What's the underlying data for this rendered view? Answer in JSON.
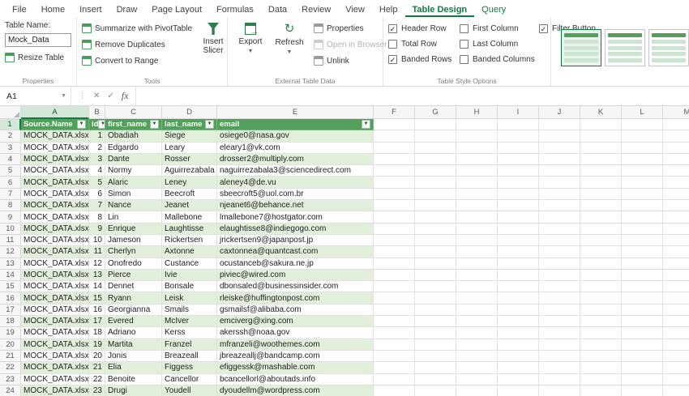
{
  "menubar": {
    "items": [
      {
        "label": "File",
        "active": false,
        "accent": false
      },
      {
        "label": "Home",
        "active": false,
        "accent": false
      },
      {
        "label": "Insert",
        "active": false,
        "accent": false
      },
      {
        "label": "Draw",
        "active": false,
        "accent": false
      },
      {
        "label": "Page Layout",
        "active": false,
        "accent": false
      },
      {
        "label": "Formulas",
        "active": false,
        "accent": false
      },
      {
        "label": "Data",
        "active": false,
        "accent": false
      },
      {
        "label": "Review",
        "active": false,
        "accent": false
      },
      {
        "label": "View",
        "active": false,
        "accent": false
      },
      {
        "label": "Help",
        "active": false,
        "accent": false
      },
      {
        "label": "Table Design",
        "active": true,
        "accent": false
      },
      {
        "label": "Query",
        "active": false,
        "accent": true
      }
    ]
  },
  "ribbon": {
    "properties_group": {
      "label": "Properties",
      "table_name_label": "Table Name:",
      "table_name_value": "Mock_Data",
      "resize_button": "Resize Table"
    },
    "tools_group": {
      "label": "Tools",
      "items": [
        "Summarize with PivotTable",
        "Remove Duplicates",
        "Convert to Range"
      ],
      "insert_slicer": "Insert Slicer"
    },
    "external_group": {
      "label": "External Table Data",
      "export": "Export",
      "refresh": "Refresh",
      "properties": "Properties",
      "open_in_browser": "Open in Browser",
      "unlink": "Unlink"
    },
    "style_options_group": {
      "label": "Table Style Options",
      "checkboxes": [
        {
          "label": "Header Row",
          "checked": true
        },
        {
          "label": "Total Row",
          "checked": false
        },
        {
          "label": "Banded Rows",
          "checked": true
        },
        {
          "label": "First Column",
          "checked": false
        },
        {
          "label": "Last Column",
          "checked": false
        },
        {
          "label": "Banded Columns",
          "checked": false
        },
        {
          "label": "Filter Button",
          "checked": true
        }
      ]
    }
  },
  "formula_bar": {
    "name_box": "A1",
    "dots": "⋮",
    "cancel": "✕",
    "enter": "✓",
    "fx": "fx",
    "formula_value": ""
  },
  "glyphs": {
    "dropdown": "▼",
    "chevron_down": "▼",
    "filter": "▼",
    "check": "✓",
    "refresh": "↻",
    "export_arrow": "→",
    "gallery_up": "▲",
    "gallery_down": "▼"
  },
  "colors": {
    "accent_green": "#107C41",
    "table_header_green": "#53A05C",
    "banded_row_green": "#E2EFDA"
  },
  "grid": {
    "column_letters": [
      "A",
      "B",
      "C",
      "D",
      "E",
      "F",
      "G",
      "H",
      "I",
      "J",
      "K",
      "L",
      "M"
    ],
    "active_cell": "A1",
    "header_row": [
      "Source.Name",
      "id",
      "first_name",
      "last_name",
      "email"
    ],
    "rows": [
      [
        "MOCK_DATA.xlsx",
        "1",
        "Obadiah",
        "Siege",
        "osiege0@nasa.gov"
      ],
      [
        "MOCK_DATA.xlsx",
        "2",
        "Edgardo",
        "Leary",
        "eleary1@vk.com"
      ],
      [
        "MOCK_DATA.xlsx",
        "3",
        "Dante",
        "Rosser",
        "drosser2@multiply.com"
      ],
      [
        "MOCK_DATA.xlsx",
        "4",
        "Normy",
        "Aguirrezabala",
        "naguirrezabala3@sciencedirect.com"
      ],
      [
        "MOCK_DATA.xlsx",
        "5",
        "Alaric",
        "Leney",
        "aleney4@de.vu"
      ],
      [
        "MOCK_DATA.xlsx",
        "6",
        "Simon",
        "Beecroft",
        "sbeecroft5@uol.com.br"
      ],
      [
        "MOCK_DATA.xlsx",
        "7",
        "Nance",
        "Jeanet",
        "njeanet6@behance.net"
      ],
      [
        "MOCK_DATA.xlsx",
        "8",
        "Lin",
        "Mallebone",
        "lmallebone7@hostgator.com"
      ],
      [
        "MOCK_DATA.xlsx",
        "9",
        "Enrique",
        "Laughtisse",
        "elaughtisse8@indiegogo.com"
      ],
      [
        "MOCK_DATA.xlsx",
        "10",
        "Jameson",
        "Rickertsen",
        "jrickertsen9@japanpost.jp"
      ],
      [
        "MOCK_DATA.xlsx",
        "11",
        "Cherlyn",
        "Axtonne",
        "caxtonnea@quantcast.com"
      ],
      [
        "MOCK_DATA.xlsx",
        "12",
        "Onofredo",
        "Custance",
        "ocustanceb@sakura.ne.jp"
      ],
      [
        "MOCK_DATA.xlsx",
        "13",
        "Pierce",
        "Ivie",
        "piviec@wired.com"
      ],
      [
        "MOCK_DATA.xlsx",
        "14",
        "Dennet",
        "Bonsale",
        "dbonsaled@businessinsider.com"
      ],
      [
        "MOCK_DATA.xlsx",
        "15",
        "Ryann",
        "Leisk",
        "rleiske@huffingtonpost.com"
      ],
      [
        "MOCK_DATA.xlsx",
        "16",
        "Georgianna",
        "Smails",
        "gsmailsf@alibaba.com"
      ],
      [
        "MOCK_DATA.xlsx",
        "17",
        "Evered",
        "McIver",
        "emciverg@xing.com"
      ],
      [
        "MOCK_DATA.xlsx",
        "18",
        "Adriano",
        "Kerss",
        "akerssh@noaa.gov"
      ],
      [
        "MOCK_DATA.xlsx",
        "19",
        "Martita",
        "Franzel",
        "mfranzeli@woothemes.com"
      ],
      [
        "MOCK_DATA.xlsx",
        "20",
        "Jonis",
        "Breazeall",
        "jbreazeallj@bandcamp.com"
      ],
      [
        "MOCK_DATA.xlsx",
        "21",
        "Elia",
        "Figgess",
        "efiggessk@mashable.com"
      ],
      [
        "MOCK_DATA.xlsx",
        "22",
        "Benoite",
        "Cancellor",
        "bcancellorl@aboutads.info"
      ],
      [
        "MOCK_DATA.xlsx",
        "23",
        "Drugi",
        "Youdell",
        "dyoudellm@wordpress.com"
      ]
    ]
  }
}
